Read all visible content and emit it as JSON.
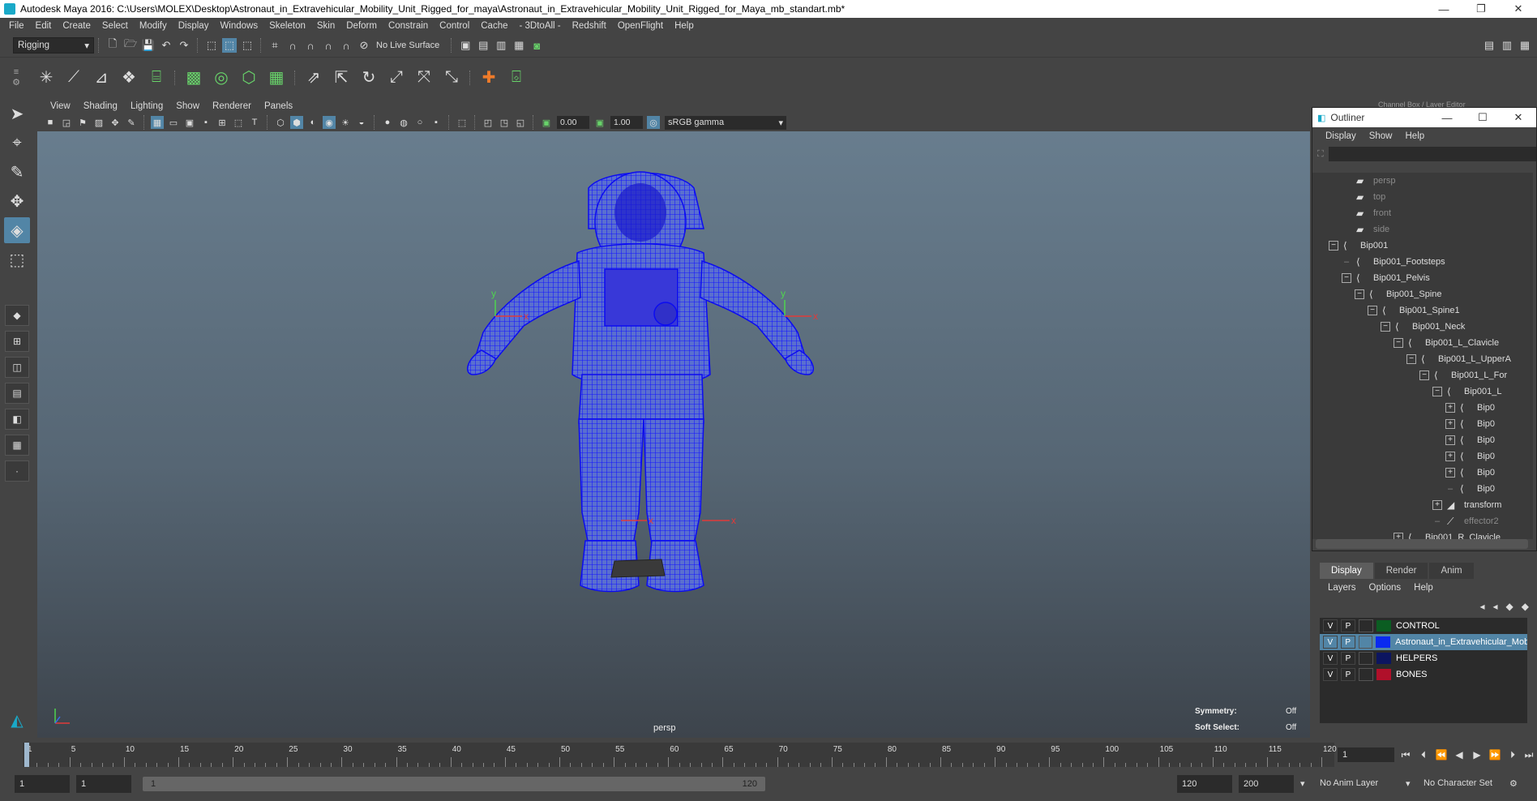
{
  "window": {
    "title": "Autodesk Maya 2016: C:\\Users\\MOLEX\\Desktop\\Astronaut_in_Extravehicular_Mobility_Unit_Rigged_for_maya\\Astronaut_in_Extravehicular_Mobility_Unit_Rigged_for_Maya_mb_standart.mb*",
    "minimize": "—",
    "restore": "❐",
    "close": "✕"
  },
  "menubar": [
    "File",
    "Edit",
    "Create",
    "Select",
    "Modify",
    "Display",
    "Windows",
    "Skeleton",
    "Skin",
    "Deform",
    "Constrain",
    "Control",
    "Cache",
    "- 3DtoAll -",
    "Redshift",
    "OpenFlight",
    "Help"
  ],
  "statusline": {
    "mode": "Rigging",
    "live_surface": "No Live Surface"
  },
  "panel": {
    "menus": [
      "View",
      "Shading",
      "Lighting",
      "Show",
      "Renderer",
      "Panels"
    ],
    "exposure": "0.00",
    "gamma": "1.00",
    "colorspace": "sRGB gamma",
    "camera": "persp",
    "symmetry_label": "Symmetry:",
    "symmetry_value": "Off",
    "soft_select_label": "Soft Select:",
    "soft_select_value": "Off",
    "channel_box_title": "Channel Box / Layer Editor"
  },
  "outliner": {
    "title": "Outliner",
    "menus": [
      "Display",
      "Show",
      "Help"
    ],
    "items": [
      {
        "label": "persp",
        "depth": 1,
        "expander": "",
        "icon": "camera",
        "dim": true
      },
      {
        "label": "top",
        "depth": 1,
        "expander": "",
        "icon": "camera",
        "dim": true
      },
      {
        "label": "front",
        "depth": 1,
        "expander": "",
        "icon": "camera",
        "dim": true
      },
      {
        "label": "side",
        "depth": 1,
        "expander": "",
        "icon": "camera",
        "dim": true
      },
      {
        "label": "Bip001",
        "depth": 0,
        "expander": "−",
        "icon": "joint",
        "dim": false
      },
      {
        "label": "Bip001_Footsteps",
        "depth": 1,
        "expander": "",
        "icon": "joint",
        "dim": false
      },
      {
        "label": "Bip001_Pelvis",
        "depth": 1,
        "expander": "−",
        "icon": "joint",
        "dim": false
      },
      {
        "label": "Bip001_Spine",
        "depth": 2,
        "expander": "−",
        "icon": "joint",
        "dim": false
      },
      {
        "label": "Bip001_Spine1",
        "depth": 3,
        "expander": "−",
        "icon": "joint",
        "dim": false
      },
      {
        "label": "Bip001_Neck",
        "depth": 4,
        "expander": "−",
        "icon": "joint",
        "dim": false
      },
      {
        "label": "Bip001_L_Clavicle",
        "depth": 5,
        "expander": "−",
        "icon": "joint",
        "dim": false
      },
      {
        "label": "Bip001_L_UpperA",
        "depth": 6,
        "expander": "−",
        "icon": "joint",
        "dim": false
      },
      {
        "label": "Bip001_L_For",
        "depth": 7,
        "expander": "−",
        "icon": "joint",
        "dim": false
      },
      {
        "label": "Bip001_L",
        "depth": 8,
        "expander": "−",
        "icon": "joint",
        "dim": false
      },
      {
        "label": "Bip0",
        "depth": 9,
        "expander": "+",
        "icon": "joint",
        "dim": false
      },
      {
        "label": "Bip0",
        "depth": 9,
        "expander": "+",
        "icon": "joint",
        "dim": false
      },
      {
        "label": "Bip0",
        "depth": 9,
        "expander": "+",
        "icon": "joint",
        "dim": false
      },
      {
        "label": "Bip0",
        "depth": 9,
        "expander": "+",
        "icon": "joint",
        "dim": false
      },
      {
        "label": "Bip0",
        "depth": 9,
        "expander": "+",
        "icon": "joint",
        "dim": false
      },
      {
        "label": "Bip0",
        "depth": 9,
        "expander": "",
        "icon": "joint",
        "dim": false
      },
      {
        "label": "transform",
        "depth": 8,
        "expander": "+",
        "icon": "transform",
        "dim": false
      },
      {
        "label": "effector2",
        "depth": 8,
        "expander": "",
        "icon": "effector",
        "dim": true
      },
      {
        "label": "Bip001_R_Clavicle",
        "depth": 5,
        "expander": "+",
        "icon": "joint",
        "dim": false
      }
    ]
  },
  "layer_editor": {
    "tabs": [
      "Display",
      "Render",
      "Anim"
    ],
    "active_tab": "Display",
    "menus": [
      "Layers",
      "Options",
      "Help"
    ],
    "layers": [
      {
        "v": "V",
        "p": "P",
        "color": "#0b5d22",
        "name": "CONTROL",
        "selected": false
      },
      {
        "v": "V",
        "p": "P",
        "color": "#0a2af0",
        "name": "Astronaut_in_Extravehicular_Mob",
        "selected": true
      },
      {
        "v": "V",
        "p": "P",
        "color": "#0c1560",
        "name": "HELPERS",
        "selected": false
      },
      {
        "v": "V",
        "p": "P",
        "color": "#b0102a",
        "name": "BONES",
        "selected": false
      }
    ]
  },
  "timeslider": {
    "ticks": [
      "1",
      "5",
      "10",
      "15",
      "20",
      "25",
      "30",
      "35",
      "40",
      "45",
      "50",
      "55",
      "60",
      "65",
      "70",
      "75",
      "80",
      "85",
      "90",
      "95",
      "100",
      "105",
      "110",
      "115",
      "120"
    ],
    "min": 1,
    "max": 120,
    "current_frame": "1"
  },
  "rangeslider": {
    "start": "1",
    "playback_start": "1",
    "range_start": "1",
    "range_end": "120",
    "playback_end": "120",
    "end": "200",
    "anim_layer": "No Anim Layer",
    "character_set": "No Character Set"
  },
  "colors": {
    "accent": "#5285a6",
    "wireframe": "#1a1aff"
  }
}
